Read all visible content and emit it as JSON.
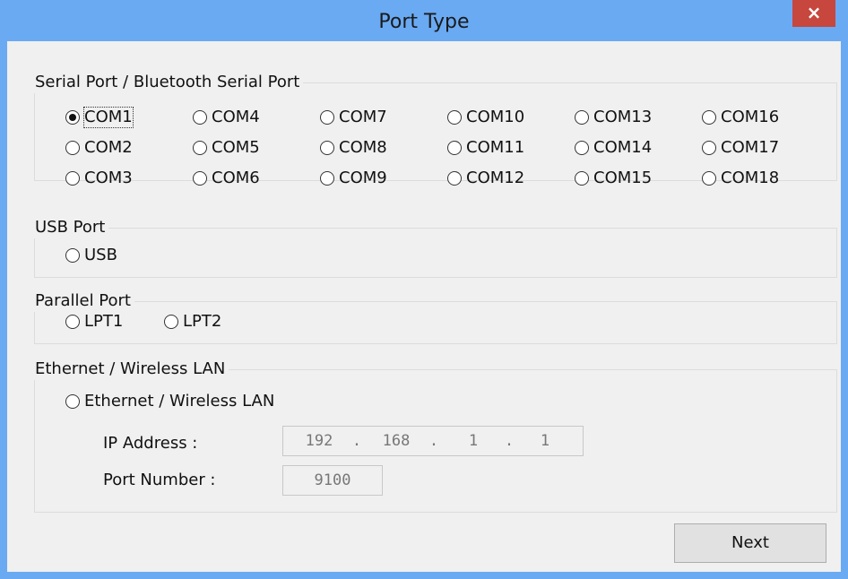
{
  "window": {
    "title": "Port Type",
    "close_glyph": "×"
  },
  "serial": {
    "legend": "Serial Port / Bluetooth Serial Port",
    "selected": "COM1",
    "ports": [
      "COM1",
      "COM2",
      "COM3",
      "COM4",
      "COM5",
      "COM6",
      "COM7",
      "COM8",
      "COM9",
      "COM10",
      "COM11",
      "COM12",
      "COM13",
      "COM14",
      "COM15",
      "COM16",
      "COM17",
      "COM18"
    ]
  },
  "usb": {
    "legend": "USB Port",
    "option": "USB"
  },
  "parallel": {
    "legend": "Parallel Port",
    "options": [
      "LPT1",
      "LPT2"
    ]
  },
  "ethernet": {
    "legend": "Ethernet / Wireless LAN",
    "option": "Ethernet / Wireless LAN",
    "ip_label": "IP Address :",
    "ip_octets": [
      "192",
      "168",
      "1",
      "1"
    ],
    "ip_separator": ".",
    "port_label": "Port Number :",
    "port_value": "9100"
  },
  "buttons": {
    "next": "Next"
  },
  "colors": {
    "titlebar": "#6aaaf3",
    "close": "#c7463e",
    "client": "#f0f0f0"
  }
}
